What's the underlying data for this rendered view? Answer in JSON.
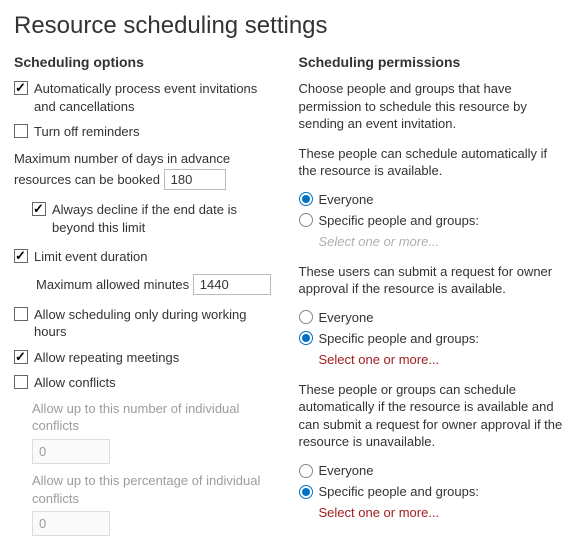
{
  "title": "Resource scheduling settings",
  "left": {
    "heading": "Scheduling options",
    "auto_process": {
      "label": "Automatically process event invitations and cancellations",
      "checked": true
    },
    "turn_off_reminders": {
      "label": "Turn off reminders",
      "checked": false
    },
    "max_days_label": "Maximum number of days in advance resources can be booked",
    "max_days_value": "180",
    "always_decline": {
      "label": "Always decline if the end date is beyond this limit",
      "checked": true
    },
    "limit_duration": {
      "label": "Limit event duration",
      "checked": true
    },
    "max_minutes_label": "Maximum allowed minutes",
    "max_minutes_value": "1440",
    "working_hours": {
      "label": "Allow scheduling only during working hours",
      "checked": false
    },
    "repeating": {
      "label": "Allow repeating meetings",
      "checked": true
    },
    "allow_conflicts": {
      "label": "Allow conflicts",
      "checked": false
    },
    "conflicts_num_label": "Allow up to this number of individual conflicts",
    "conflicts_num_value": "0",
    "conflicts_pct_label": "Allow up to this percentage of individual conflicts",
    "conflicts_pct_value": "0"
  },
  "right": {
    "heading": "Scheduling permissions",
    "intro": "Choose people and groups that have permission to schedule this resource by sending an event invitation.",
    "group1": {
      "desc": "These people can schedule automatically if the resource is available.",
      "opt_everyone": "Everyone",
      "opt_specific": "Specific people and groups:",
      "selected": "everyone",
      "link": "Select one or more..."
    },
    "group2": {
      "desc": "These users can submit a request for owner approval if the resource is available.",
      "opt_everyone": "Everyone",
      "opt_specific": "Specific people and groups:",
      "selected": "specific",
      "link": "Select one or more..."
    },
    "group3": {
      "desc": "These people or groups can schedule automatically if the resource is available and can submit a request for owner approval if the resource is unavailable.",
      "opt_everyone": "Everyone",
      "opt_specific": "Specific people and groups:",
      "selected": "specific",
      "link": "Select one or more..."
    }
  }
}
